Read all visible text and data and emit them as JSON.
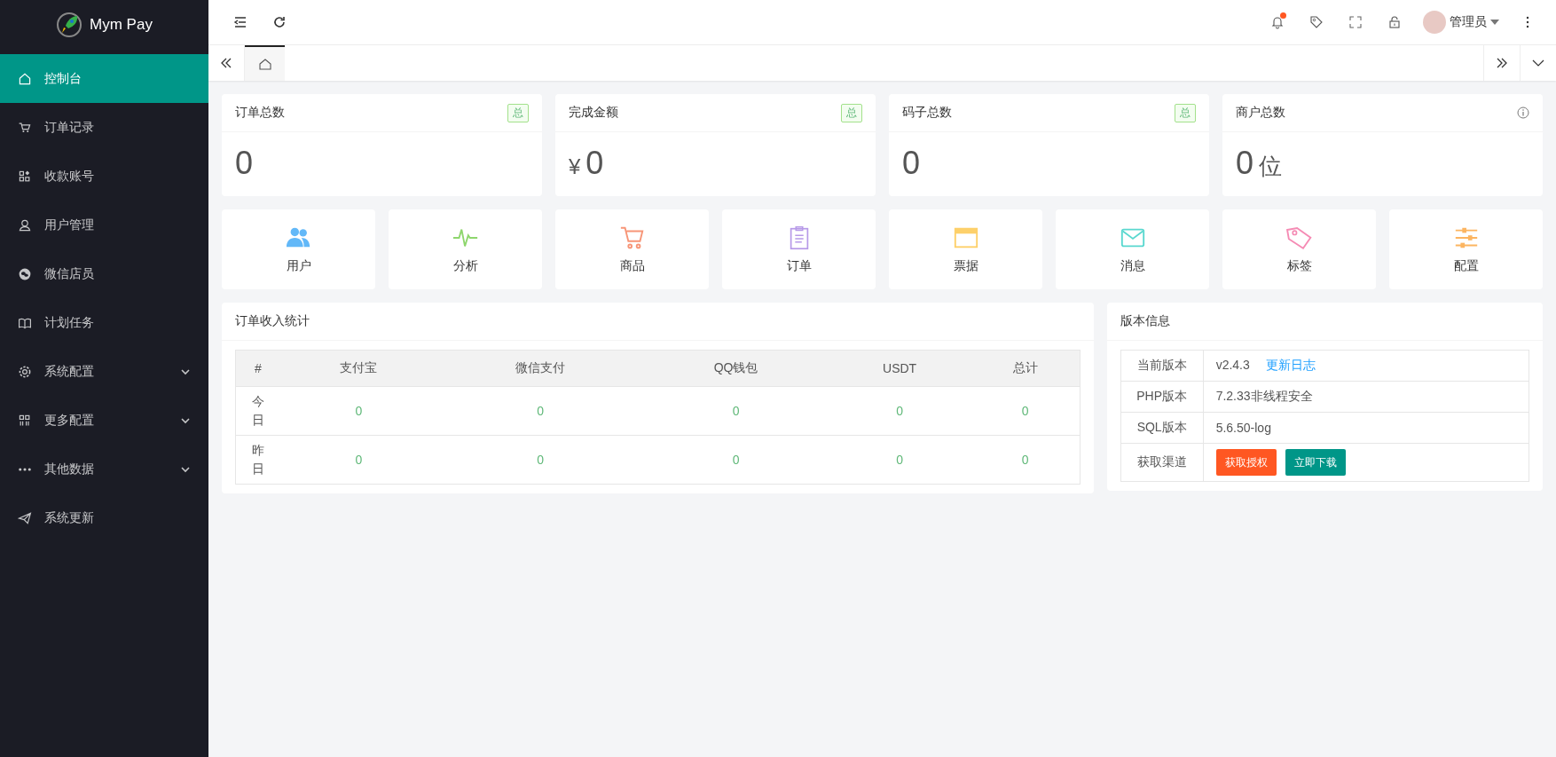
{
  "sidebar": {
    "logo": "Mym Pay",
    "items": [
      {
        "label": "控制台",
        "kind": "link",
        "selected": true
      },
      {
        "label": "订单记录",
        "kind": "link",
        "selected": false
      },
      {
        "label": "收款账号",
        "kind": "link",
        "selected": false
      },
      {
        "label": "用户管理",
        "kind": "link",
        "selected": false
      },
      {
        "label": "微信店员",
        "kind": "link",
        "selected": false
      },
      {
        "label": "计划任务",
        "kind": "link",
        "selected": false
      },
      {
        "label": "系统配置",
        "kind": "group",
        "selected": false
      },
      {
        "label": "更多配置",
        "kind": "group",
        "selected": false
      },
      {
        "label": "其他数据",
        "kind": "group",
        "selected": false
      },
      {
        "label": "系统更新",
        "kind": "link",
        "selected": false
      }
    ]
  },
  "header": {
    "unread_notifications": true,
    "user": "管理员"
  },
  "tabs": [
    {
      "selected": true
    }
  ],
  "stat_cards": [
    {
      "title": "订单总数",
      "badge": "总",
      "value": "0"
    },
    {
      "title": "完成金额",
      "badge": "总",
      "prefix": "¥",
      "value": "0"
    },
    {
      "title": "码子总数",
      "badge": "总",
      "value": "0"
    },
    {
      "title": "商户总数",
      "value": "0",
      "unit": "位"
    }
  ],
  "shortcuts": [
    "用户",
    "分析",
    "商品",
    "订单",
    "票据",
    "消息",
    "标签",
    "配置"
  ],
  "order_stats": {
    "title": "订单收入统计",
    "columns": [
      "#",
      "支付宝",
      "微信支付",
      "QQ钱包",
      "USDT",
      "总计"
    ],
    "rows": [
      [
        "今日",
        "0",
        "0",
        "0",
        "0",
        "0"
      ],
      [
        "昨日",
        "0",
        "0",
        "0",
        "0",
        "0"
      ]
    ]
  },
  "version_info": {
    "title": "版本信息",
    "rows": [
      {
        "label": "当前版本",
        "value": "v2.4.3",
        "link": "更新日志"
      },
      {
        "label": "PHP版本",
        "value": "7.2.33非线程安全"
      },
      {
        "label": "SQL版本",
        "value": "5.6.50-log"
      },
      {
        "label": "获取渠道",
        "buttons": [
          {
            "label": "获取授权",
            "kind": "warm"
          },
          {
            "label": "立即下载",
            "kind": "primary"
          }
        ]
      }
    ]
  }
}
